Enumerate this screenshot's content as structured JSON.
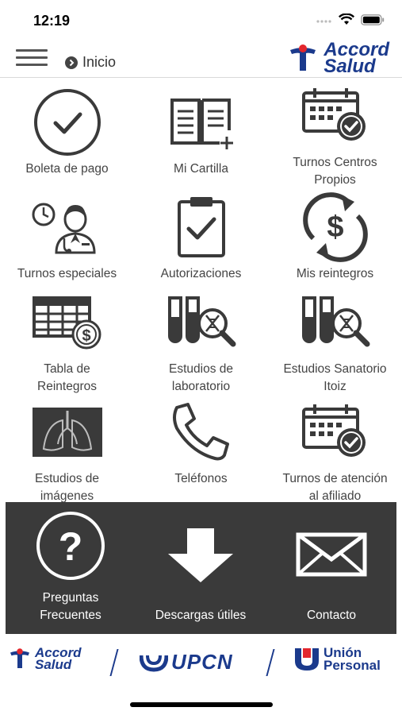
{
  "status_bar": {
    "time": "12:19"
  },
  "header": {
    "breadcrumb": "Inicio",
    "brand_line1": "Accord",
    "brand_line2": "Salud",
    "colors": {
      "brand_blue": "#1b3a8c",
      "brand_red": "#e3262d"
    }
  },
  "grid": {
    "items": [
      {
        "label": "Boleta de pago",
        "icon": "check-circle-icon"
      },
      {
        "label": "Mi Cartilla",
        "icon": "open-book-icon"
      },
      {
        "label": "Turnos Centros\nPropios",
        "icon": "calendar-check-icon"
      },
      {
        "label": "Turnos especiales",
        "icon": "doctor-clock-icon"
      },
      {
        "label": "Autorizaciones",
        "icon": "clipboard-check-icon"
      },
      {
        "label": "Mis reintegros",
        "icon": "dollar-cycle-icon"
      },
      {
        "label": "Tabla de\nReintegros",
        "icon": "table-dollar-icon"
      },
      {
        "label": "Estudios de\nlaboratorio",
        "icon": "test-tubes-dna-icon"
      },
      {
        "label": "Estudios Sanatorio\nItoiz",
        "icon": "test-tubes-dna-icon"
      },
      {
        "label": "Estudios de\nimágenes",
        "icon": "xray-lungs-icon"
      },
      {
        "label": "Teléfonos",
        "icon": "phone-icon"
      },
      {
        "label": "Turnos de atención\nal afiliado",
        "icon": "calendar-check-icon"
      }
    ]
  },
  "bottom_panel": {
    "items": [
      {
        "label": "Preguntas\nFrecuentes",
        "icon": "question-circle-icon"
      },
      {
        "label": "Descargas útiles",
        "icon": "download-arrow-icon"
      },
      {
        "label": "Contacto",
        "icon": "envelope-icon"
      }
    ]
  },
  "footer": {
    "logo1_line1": "Accord",
    "logo1_line2": "Salud",
    "logo2": "UPCN",
    "logo3_line1": "Unión",
    "logo3_line2": "Personal"
  }
}
